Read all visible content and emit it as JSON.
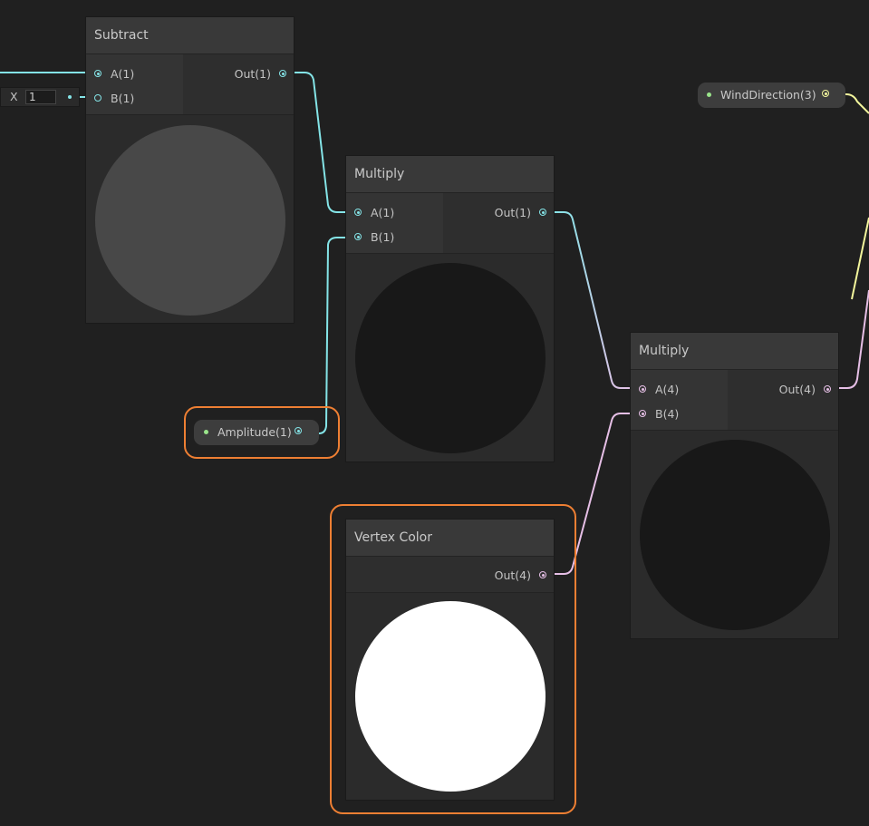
{
  "nodes": {
    "subtract": {
      "title": "Subtract",
      "in_a": "A(1)",
      "in_b": "B(1)",
      "out": "Out(1)"
    },
    "multiply_1": {
      "title": "Multiply",
      "in_a": "A(1)",
      "in_b": "B(1)",
      "out": "Out(1)"
    },
    "multiply_2": {
      "title": "Multiply",
      "in_a": "A(4)",
      "in_b": "B(4)",
      "out": "Out(4)"
    },
    "vertex_color": {
      "title": "Vertex Color",
      "out": "Out(4)"
    }
  },
  "properties": {
    "amplitude": "Amplitude(1)",
    "wind_direction": "WindDirection(3)"
  },
  "inline_input": {
    "axis": "X",
    "value": "1"
  },
  "colors": {
    "float_port": "#84e4e7",
    "vector4_port": "#e6bfe6",
    "vector3_port": "#f2f59c",
    "highlight": "#ee7f33",
    "subtract_preview": "#484848",
    "multiply_preview": "#181818",
    "vertex_color_preview": "#ffffff"
  }
}
